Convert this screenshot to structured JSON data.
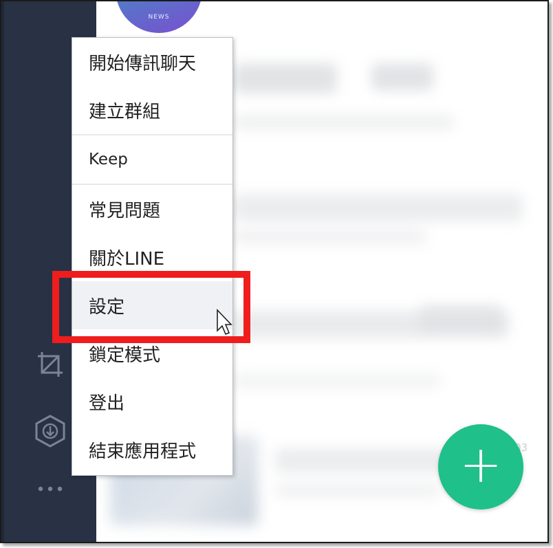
{
  "sidebar": {
    "icons": [
      "crop-icon",
      "download-icon",
      "more-icon"
    ]
  },
  "main": {
    "avatar_text": "NEWS",
    "time_label": "03"
  },
  "fab": {
    "label": "+",
    "color": "#1fc08a"
  },
  "menu": {
    "groups": [
      {
        "items": [
          {
            "label": "開始傳訊聊天"
          },
          {
            "label": "建立群組"
          }
        ]
      },
      {
        "items": [
          {
            "label": "Keep"
          }
        ]
      },
      {
        "items": [
          {
            "label": "常見問題"
          },
          {
            "label": "關於LINE"
          },
          {
            "label": "設定"
          },
          {
            "label": "鎖定模式"
          },
          {
            "label": "登出"
          },
          {
            "label": "結束應用程式"
          }
        ]
      }
    ],
    "hovered": "設定"
  },
  "colors": {
    "sidebar": "#283244",
    "highlight": "#ef1d1d",
    "accent": "#1fc08a"
  }
}
